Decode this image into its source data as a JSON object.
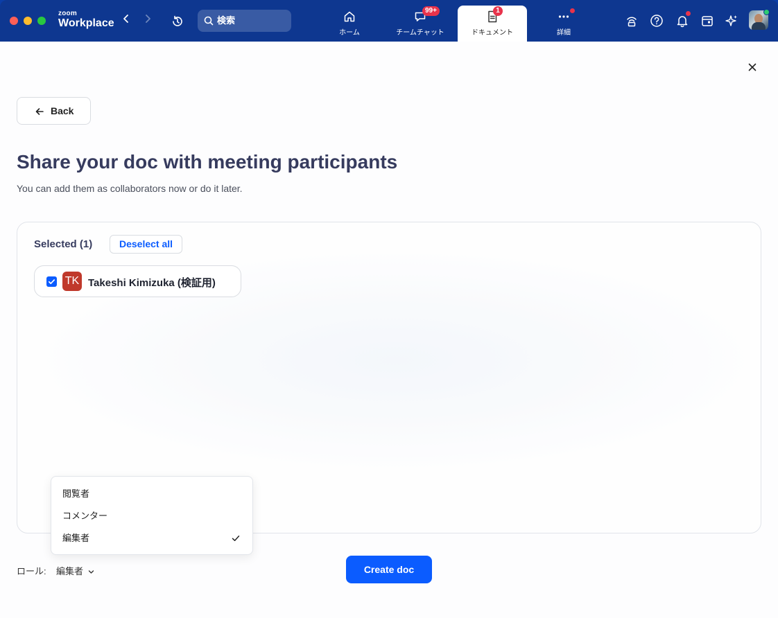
{
  "app": {
    "brand_small": "zoom",
    "brand_large": "Workplace",
    "search_label": "検索"
  },
  "tabs": [
    {
      "label": "ホーム",
      "icon": "home-icon"
    },
    {
      "label": "チームチャット",
      "icon": "chat-icon",
      "badge": "99+"
    },
    {
      "label": "ドキュメント",
      "icon": "document-icon",
      "badge": "1",
      "active": true
    },
    {
      "label": "詳細",
      "icon": "more-icon"
    }
  ],
  "toolbar_icons": [
    "wireless-icon",
    "help-icon",
    "bell-icon",
    "calendar-icon",
    "sparkle-icon"
  ],
  "page": {
    "back_label": "Back",
    "title": "Share your doc with meeting participants",
    "subtitle": "You can add them as collaborators now or do it later."
  },
  "selection": {
    "count_label": "Selected (1)",
    "deselect_label": "Deselect all",
    "participants": [
      {
        "initials": "TK",
        "name": "Takeshi Kimizuka (検証用)",
        "checked": true
      }
    ]
  },
  "role": {
    "label": "ロール:",
    "selected": "編集者",
    "options": [
      "閲覧者",
      "コメンター",
      "編集者"
    ]
  },
  "create_label": "Create doc",
  "colors": {
    "titlebar": "#0e3790",
    "accent": "#0b5cff",
    "badge": "#e8334b",
    "title_text": "#363b5e"
  }
}
